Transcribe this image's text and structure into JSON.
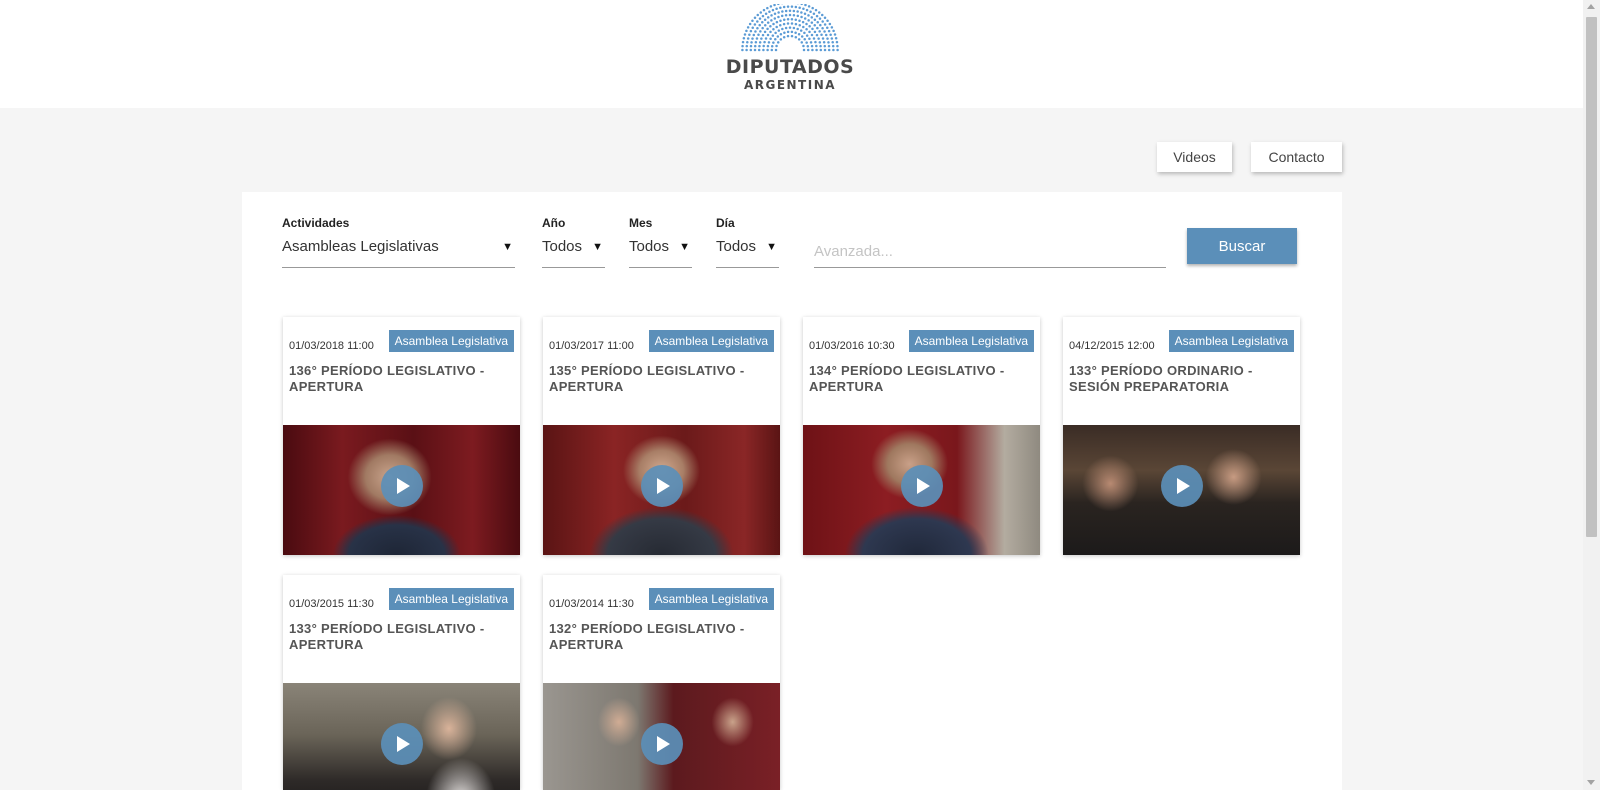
{
  "header": {
    "logo_title": "DIPUTADOS",
    "logo_subtitle": "ARGENTINA",
    "logo_color": "#5b9bd5"
  },
  "nav": {
    "videos": "Videos",
    "contacto": "Contacto"
  },
  "filters": {
    "actividades": {
      "label": "Actividades",
      "value": "Asambleas Legislativas"
    },
    "anio": {
      "label": "Año",
      "value": "Todos"
    },
    "mes": {
      "label": "Mes",
      "value": "Todos"
    },
    "dia": {
      "label": "Día",
      "value": "Todos"
    },
    "search": {
      "placeholder": "Avanzada...",
      "value": ""
    },
    "button_label": "Buscar"
  },
  "accent_color": "#5b8fb9",
  "cards": [
    {
      "date": "01/03/2018 11:00",
      "badge": "Asamblea Legislativa",
      "title": "136° PERÍODO LEGISLATIVO - APERTURA"
    },
    {
      "date": "01/03/2017 11:00",
      "badge": "Asamblea Legislativa",
      "title": "135° PERÍODO LEGISLATIVO - APERTURA"
    },
    {
      "date": "01/03/2016 10:30",
      "badge": "Asamblea Legislativa",
      "title": "134° PERÍODO LEGISLATIVO - APERTURA"
    },
    {
      "date": "04/12/2015 12:00",
      "badge": "Asamblea Legislativa",
      "title": "133° PERÍODO ORDINARIO - SESIÓN PREPARATORIA"
    },
    {
      "date": "01/03/2015 11:30",
      "badge": "Asamblea Legislativa",
      "title": "133° PERÍODO LEGISLATIVO - APERTURA"
    },
    {
      "date": "01/03/2014 11:30",
      "badge": "Asamblea Legislativa",
      "title": "132° PERÍODO LEGISLATIVO - APERTURA"
    }
  ]
}
